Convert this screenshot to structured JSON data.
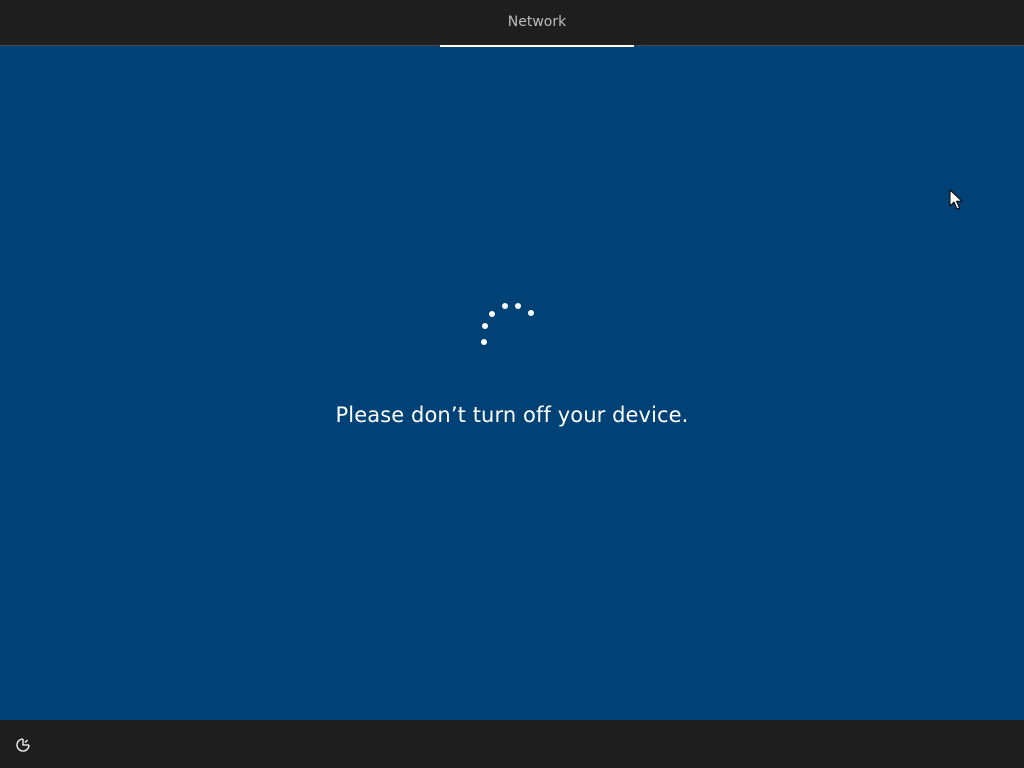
{
  "header": {
    "tab_label": "Network"
  },
  "main": {
    "message": "Please don’t turn off your device."
  },
  "icons": {
    "spinner": "loading-spinner-icon",
    "ease_of_access": "ease-of-access-icon",
    "cursor": "mouse-pointer-icon"
  },
  "colors": {
    "background": "#004275",
    "bars": "#1f1f1f",
    "text": "#ffffff",
    "tab_text": "#bdbdbd"
  }
}
